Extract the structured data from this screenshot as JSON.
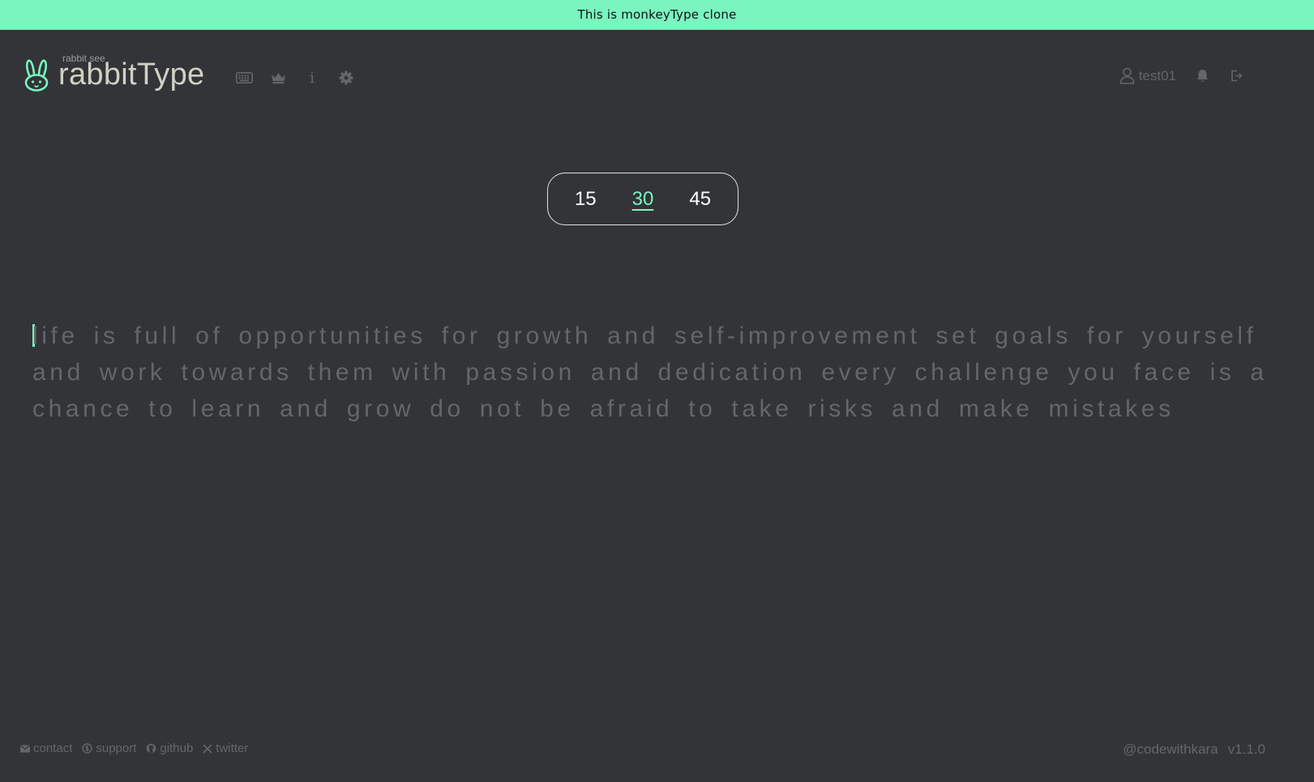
{
  "banner": {
    "text": "This is monkeyType clone"
  },
  "logo": {
    "top_text": "rabbit see",
    "title": "rabbitType",
    "icon": "rabbit-icon"
  },
  "nav": [
    {
      "icon": "keyboard-icon"
    },
    {
      "icon": "crown-icon"
    },
    {
      "icon": "info-icon"
    },
    {
      "icon": "gear-icon"
    }
  ],
  "user": {
    "username": "test01",
    "icons": [
      "user-icon",
      "bell-icon",
      "logout-icon"
    ]
  },
  "time_options": {
    "option_15": "15",
    "option_30": "30",
    "option_45": "45",
    "selected": "30"
  },
  "typing": {
    "text": "life is full of opportunities for growth and self-improvement set goals for yourself and work towards them with passion and dedication every challenge you face is a chance to learn and grow do not be afraid to take risks and make mistakes"
  },
  "footer": {
    "contact": "contact",
    "support": "support",
    "github": "github",
    "twitter": "twitter",
    "handle": "@codewithkara",
    "version": "v1.1.0"
  },
  "colors": {
    "background": "#323437",
    "accent": "#7af5bf",
    "text_dim": "#646669",
    "text_main": "#d1d0c5"
  }
}
